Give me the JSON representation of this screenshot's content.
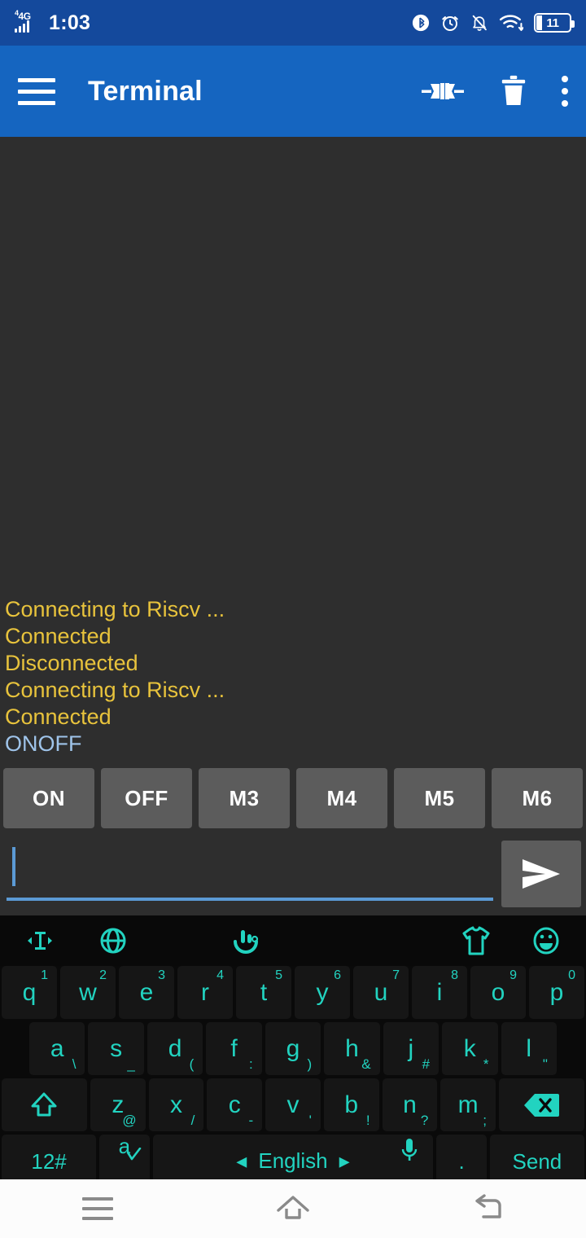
{
  "status_bar": {
    "network_label": "4G",
    "time": "1:03",
    "battery_level": "11",
    "icons": [
      "signal-bars-icon",
      "bluetooth-icon",
      "alarm-icon",
      "notifications-off-icon",
      "wifi-icon",
      "battery-icon"
    ]
  },
  "app_bar": {
    "title": "Terminal",
    "menu_icon": "hamburger-menu-icon",
    "actions": [
      {
        "name": "connect-icon",
        "label": "Connect"
      },
      {
        "name": "delete-icon",
        "label": "Clear"
      },
      {
        "name": "overflow-menu-icon",
        "label": "More options"
      }
    ]
  },
  "terminal": {
    "lines": [
      {
        "text": "Connecting to Riscv ...",
        "type": "rx"
      },
      {
        "text": "Connected",
        "type": "rx"
      },
      {
        "text": "Disconnected",
        "type": "rx"
      },
      {
        "text": "Connecting to Riscv ...",
        "type": "rx"
      },
      {
        "text": "Connected",
        "type": "rx"
      },
      {
        "text": "ONOFF",
        "type": "tx"
      }
    ],
    "rx_color": "#e8c33c",
    "tx_color": "#9fc4ea",
    "background": "#2e2e2e"
  },
  "macros": {
    "buttons": [
      "ON",
      "OFF",
      "M3",
      "M4",
      "M5",
      "M6"
    ],
    "button_color": "#5c5c5c"
  },
  "input_row": {
    "value": "",
    "placeholder": "",
    "send_icon": "send-icon",
    "underline_color": "#5b9ad5"
  },
  "keyboard": {
    "toolbar_icons": [
      "text-cursor-icon",
      "globe-icon",
      "touchpal-logo-icon",
      "theme-shirt-icon",
      "emoji-icon"
    ],
    "row1": [
      {
        "main": "q",
        "num": "1"
      },
      {
        "main": "w",
        "num": "2"
      },
      {
        "main": "e",
        "num": "3"
      },
      {
        "main": "r",
        "num": "4"
      },
      {
        "main": "t",
        "num": "5"
      },
      {
        "main": "y",
        "num": "6"
      },
      {
        "main": "u",
        "num": "7"
      },
      {
        "main": "i",
        "num": "8"
      },
      {
        "main": "o",
        "num": "9"
      },
      {
        "main": "p",
        "num": "0"
      }
    ],
    "row2": [
      {
        "main": "a",
        "alt": "\\"
      },
      {
        "main": "s",
        "alt": "_"
      },
      {
        "main": "d",
        "alt": "("
      },
      {
        "main": "f",
        "alt": ":"
      },
      {
        "main": "g",
        "alt": ")"
      },
      {
        "main": "h",
        "alt": "&"
      },
      {
        "main": "j",
        "alt": "#"
      },
      {
        "main": "k",
        "alt": "*"
      },
      {
        "main": "l",
        "alt": "\""
      }
    ],
    "row3": [
      {
        "main": "z",
        "alt": "@"
      },
      {
        "main": "x",
        "alt": "/"
      },
      {
        "main": "c",
        "alt": "-"
      },
      {
        "main": "v",
        "alt": "'"
      },
      {
        "main": "b",
        "alt": "!"
      },
      {
        "main": "n",
        "alt": "?"
      },
      {
        "main": "m",
        "alt": ";"
      }
    ],
    "shift_key": "shift-icon",
    "backspace_key": "backspace-icon",
    "row4": {
      "symbols_label": "12#",
      "lang_switch_label": "a",
      "lang_switch_alt": ",",
      "space_label": "English",
      "space_prev": "◂",
      "space_next": "▸",
      "mic_icon": "microphone-icon",
      "period_label": ".",
      "send_label": "Send"
    },
    "key_text_color": "#22d3c0",
    "key_background": "#161616"
  },
  "nav_bar": {
    "recents_icon": "recents-icon",
    "home_icon": "home-icon",
    "back_icon": "back-icon"
  }
}
